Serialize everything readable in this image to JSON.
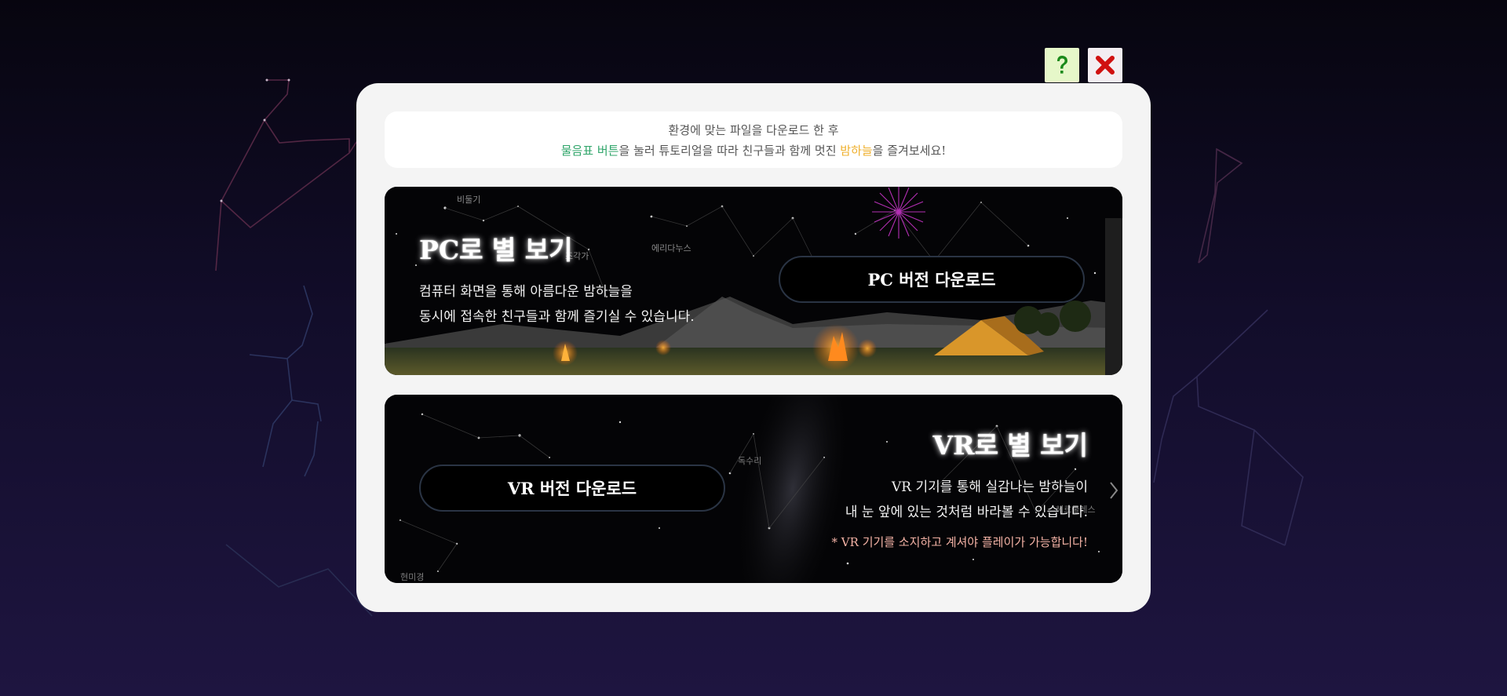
{
  "buttons": {
    "help_icon": "question-mark-icon",
    "close_icon": "close-x-icon"
  },
  "notice": {
    "line1": "환경에 맞는 파일을 다운로드 한 후",
    "line2_green": "물음표 버튼",
    "line2_a": "을 눌러 튜토리얼을 따라 친구들과 함께 멋진 ",
    "line2_yellow": "밤하늘",
    "line2_b": "을 즐겨보세요!"
  },
  "pc": {
    "title": "PC로 별 보기",
    "desc1": "컴퓨터 화면을 통해 아름다운 밤하늘을",
    "desc2": "동시에 접속한 친구들과 함께 즐기실 수 있습니다.",
    "button": "PC 버전 다운로드",
    "scene_labels": [
      "비둘기",
      "에리다누스",
      "조각가"
    ]
  },
  "vr": {
    "title": "VR로 별 보기",
    "desc1": "VR 기기를 통해 실감나는 밤하늘이",
    "desc2": "내 눈 앞에 있는 것처럼 바라볼 수 있습니다.",
    "note": "* VR 기기를 소지하고 계셔야 플레이가 가능합니다!",
    "button": "VR 버전 다운로드",
    "scene_labels": [
      "독수리",
      "헤르쿨레스",
      "현미경"
    ]
  },
  "colors": {
    "accent_green": "#2fa56a",
    "accent_yellow": "#efb02e",
    "help_bg": "#e6f7c9",
    "close_red": "#d01010",
    "modal_bg": "#f4f4f4"
  }
}
